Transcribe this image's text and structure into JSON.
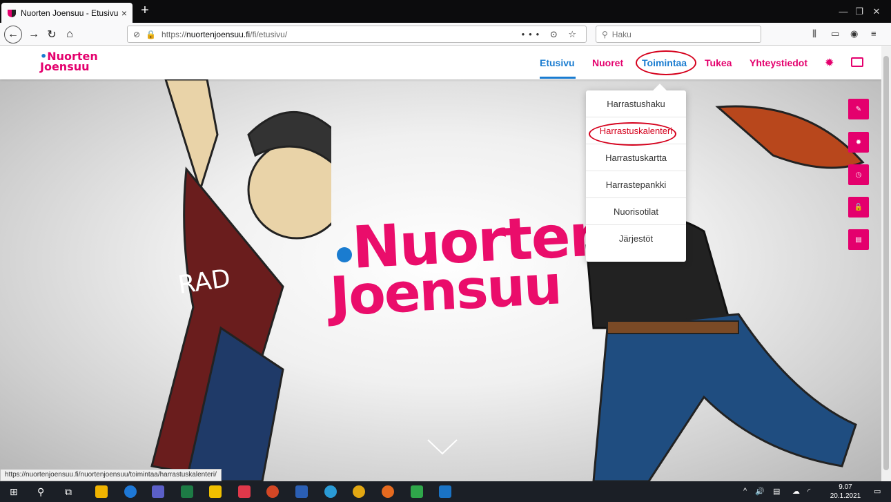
{
  "browser": {
    "tab_title": "Nuorten Joensuu - Etusivu",
    "tab_close": "×",
    "new_tab": "+",
    "url_prefix": "https://",
    "url_domain": "nuortenjoensuu.fi",
    "url_path": "/fi/etusivu/",
    "url_actions": "••• ⊙ ☆",
    "search_placeholder": "Haku",
    "status_url": "https://nuortenjoensuu.fi/nuortenjoensuu/toimintaa/harrastuskalenteri/"
  },
  "site": {
    "logo_line1": "Nuorten",
    "logo_line2": "Joensuu",
    "nav": [
      "Etusivu",
      "Nuoret",
      "Toimintaa",
      "Tukea",
      "Yhteystiedot"
    ],
    "dropdown": [
      "Harrastushaku",
      "Harrastuskalenteri",
      "Harrastuskartta",
      "Harrastepankki",
      "Nuorisotilat",
      "Järjestöt"
    ],
    "hero_logo_line1": "Nuorten",
    "hero_logo_line2": "Joensuu"
  },
  "taskbar": {
    "time": "9.07",
    "date": "20.1.2021"
  },
  "colors": {
    "brand_pink": "#e4006d",
    "brand_blue": "#1a7cd0",
    "annotation_red": "#d5001c"
  },
  "icons": [
    "pencil-icon",
    "gear-icon",
    "clock-icon",
    "unlock-icon",
    "book-icon",
    "id-card-icon",
    "chevron-down-icon"
  ]
}
